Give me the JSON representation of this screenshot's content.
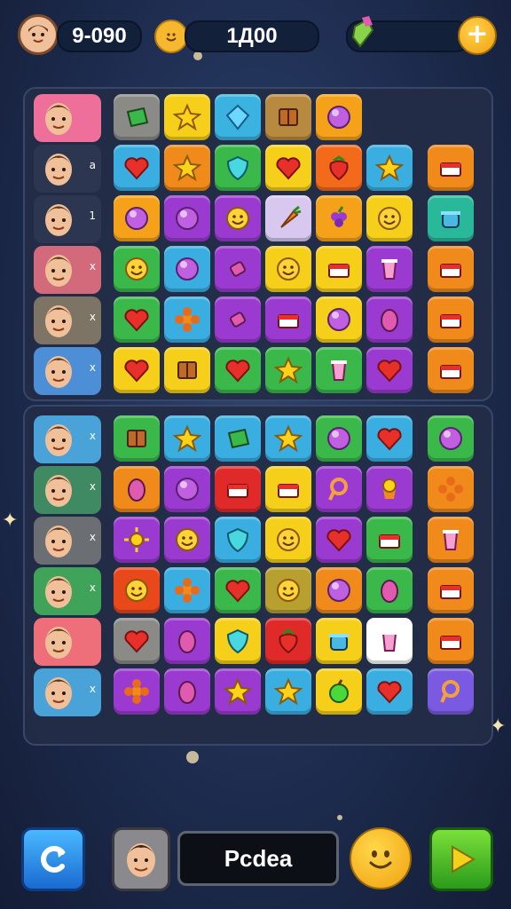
{
  "hud": {
    "score": "9-090",
    "coins": "1Д00",
    "add_label": "+"
  },
  "players_top": [
    {
      "mark": "",
      "color": "#ee6f9a"
    },
    {
      "mark": "a",
      "color": "#2c3650"
    },
    {
      "mark": "1",
      "color": "#2c3650"
    },
    {
      "mark": "x",
      "color": "#d26a7c"
    },
    {
      "mark": "x",
      "color": "#7e7466"
    },
    {
      "mark": "x",
      "color": "#4c8fd6"
    }
  ],
  "players_bottom": [
    {
      "mark": "x",
      "color": "#4aa3d8"
    },
    {
      "mark": "x",
      "color": "#3f8a63"
    },
    {
      "mark": "x",
      "color": "#6b6f74"
    },
    {
      "mark": "x",
      "color": "#3fa45a"
    },
    {
      "mark": "",
      "color": "#ee6f7a"
    },
    {
      "mark": "x",
      "color": "#4aa3d8"
    }
  ],
  "grid_top": [
    [
      {
        "c": "#8a8a86",
        "i": "gem-square-icon"
      },
      {
        "c": "#f5cf1a",
        "i": "star-icon"
      },
      {
        "c": "#3ab3e0",
        "i": "diamond-icon"
      },
      {
        "c": "#b88a40",
        "i": "box-icon"
      },
      {
        "c": "#f5a21a",
        "i": "orb-icon"
      },
      null
    ],
    [
      {
        "c": "#3aaee0",
        "i": "heart-icon"
      },
      {
        "c": "#f08a1a",
        "i": "star-icon"
      },
      {
        "c": "#3ab84a",
        "i": "shield-icon"
      },
      {
        "c": "#f5cf1a",
        "i": "heart-icon"
      },
      {
        "c": "#f26a1a",
        "i": "strawberry-icon"
      },
      {
        "c": "#3aaee0",
        "i": "star-icon"
      }
    ],
    [
      {
        "c": "#f5a21a",
        "i": "orb-icon"
      },
      {
        "c": "#9a3ad0",
        "i": "orb-icon"
      },
      {
        "c": "#9a3ad0",
        "i": "smile-icon"
      },
      {
        "c": "#d8c8f0",
        "i": "carrot-icon"
      },
      {
        "c": "#f5a21a",
        "i": "grape-icon"
      },
      {
        "c": "#f5cf1a",
        "i": "smile-icon"
      }
    ],
    [
      {
        "c": "#3ab84a",
        "i": "smile-icon"
      },
      {
        "c": "#3aaee0",
        "i": "orb-icon"
      },
      {
        "c": "#9a3ad0",
        "i": "candy-icon"
      },
      {
        "c": "#f5cf1a",
        "i": "smile-icon"
      },
      {
        "c": "#f5cf1a",
        "i": "cake-icon"
      },
      {
        "c": "#9a3ad0",
        "i": "cup-icon"
      }
    ],
    [
      {
        "c": "#3ab84a",
        "i": "heart-icon"
      },
      {
        "c": "#3aaee0",
        "i": "flower-icon"
      },
      {
        "c": "#9a3ad0",
        "i": "candy-icon"
      },
      {
        "c": "#9a3ad0",
        "i": "cake-icon"
      },
      {
        "c": "#f5cf1a",
        "i": "orb-icon"
      },
      {
        "c": "#9a3ad0",
        "i": "egg-icon"
      }
    ],
    [
      {
        "c": "#f5cf1a",
        "i": "heart-icon"
      },
      {
        "c": "#f5cf1a",
        "i": "box-icon"
      },
      {
        "c": "#3ab84a",
        "i": "heart-icon"
      },
      {
        "c": "#3ab84a",
        "i": "star-icon"
      },
      {
        "c": "#3ab84a",
        "i": "cup-icon"
      },
      {
        "c": "#9a3ad0",
        "i": "heart-icon"
      }
    ]
  ],
  "side_top": [
    null,
    {
      "c": "#f08a1a",
      "i": "cake-icon"
    },
    {
      "c": "#2ab89a",
      "i": "pot-icon"
    },
    {
      "c": "#f08a1a",
      "i": "cake-icon"
    },
    {
      "c": "#f08a1a",
      "i": "cake-icon"
    },
    {
      "c": "#f08a1a",
      "i": "cake-icon"
    }
  ],
  "grid_bottom": [
    [
      {
        "c": "#3ab84a",
        "i": "box-icon"
      },
      {
        "c": "#3aaee0",
        "i": "star-icon"
      },
      {
        "c": "#3aaee0",
        "i": "gem-square-icon"
      },
      {
        "c": "#3aaee0",
        "i": "star-icon"
      },
      {
        "c": "#3ab84a",
        "i": "orb-icon"
      },
      {
        "c": "#3aaee0",
        "i": "heart-icon"
      }
    ],
    [
      {
        "c": "#f08a1a",
        "i": "egg-icon"
      },
      {
        "c": "#9a3ad0",
        "i": "orb-icon"
      },
      {
        "c": "#e02a2a",
        "i": "cake-icon"
      },
      {
        "c": "#f5cf1a",
        "i": "cake-icon"
      },
      {
        "c": "#9a3ad0",
        "i": "ring-icon"
      },
      {
        "c": "#9a3ad0",
        "i": "cupcake-icon"
      }
    ],
    [
      {
        "c": "#9a3ad0",
        "i": "sun-icon"
      },
      {
        "c": "#9a3ad0",
        "i": "smile-icon"
      },
      {
        "c": "#3aaee0",
        "i": "shield-icon"
      },
      {
        "c": "#f5cf1a",
        "i": "smile-icon"
      },
      {
        "c": "#9a3ad0",
        "i": "heart-icon"
      },
      {
        "c": "#3ab84a",
        "i": "cake-icon"
      }
    ],
    [
      {
        "c": "#e8481a",
        "i": "smile-icon"
      },
      {
        "c": "#3aaee0",
        "i": "flower-icon"
      },
      {
        "c": "#3ab84a",
        "i": "heart-icon"
      },
      {
        "c": "#b8a030",
        "i": "smile-icon"
      },
      {
        "c": "#f08a1a",
        "i": "orb-icon"
      },
      {
        "c": "#3ab84a",
        "i": "egg-icon"
      }
    ],
    [
      {
        "c": "#8a8a86",
        "i": "heart-icon"
      },
      {
        "c": "#9a3ad0",
        "i": "egg-icon"
      },
      {
        "c": "#f5cf1a",
        "i": "shield-icon"
      },
      {
        "c": "#e02a2a",
        "i": "strawberry-icon"
      },
      {
        "c": "#f5cf1a",
        "i": "pot-icon"
      },
      {
        "c": "#ffffff",
        "i": "cup-icon"
      }
    ],
    [
      {
        "c": "#9a3ad0",
        "i": "flower-icon"
      },
      {
        "c": "#9a3ad0",
        "i": "egg-icon"
      },
      {
        "c": "#9a3ad0",
        "i": "star-icon"
      },
      {
        "c": "#3aaee0",
        "i": "star-icon"
      },
      {
        "c": "#f5cf1a",
        "i": "apple-icon"
      },
      {
        "c": "#3aaee0",
        "i": "heart-icon"
      }
    ]
  ],
  "side_bottom": [
    {
      "c": "#3ab84a",
      "i": "orb-icon"
    },
    {
      "c": "#f08a1a",
      "i": "flower-icon"
    },
    {
      "c": "#f08a1a",
      "i": "cup-icon"
    },
    {
      "c": "#f08a1a",
      "i": "cake-icon"
    },
    {
      "c": "#f08a1a",
      "i": "cake-icon"
    },
    {
      "c": "#7a5ae0",
      "i": "ring-icon"
    }
  ],
  "bottom_bar": {
    "player_name": "Pcdea",
    "refresh_icon": "refresh-icon",
    "emoji_icon": "smiley-icon",
    "play_icon": "play-icon"
  }
}
